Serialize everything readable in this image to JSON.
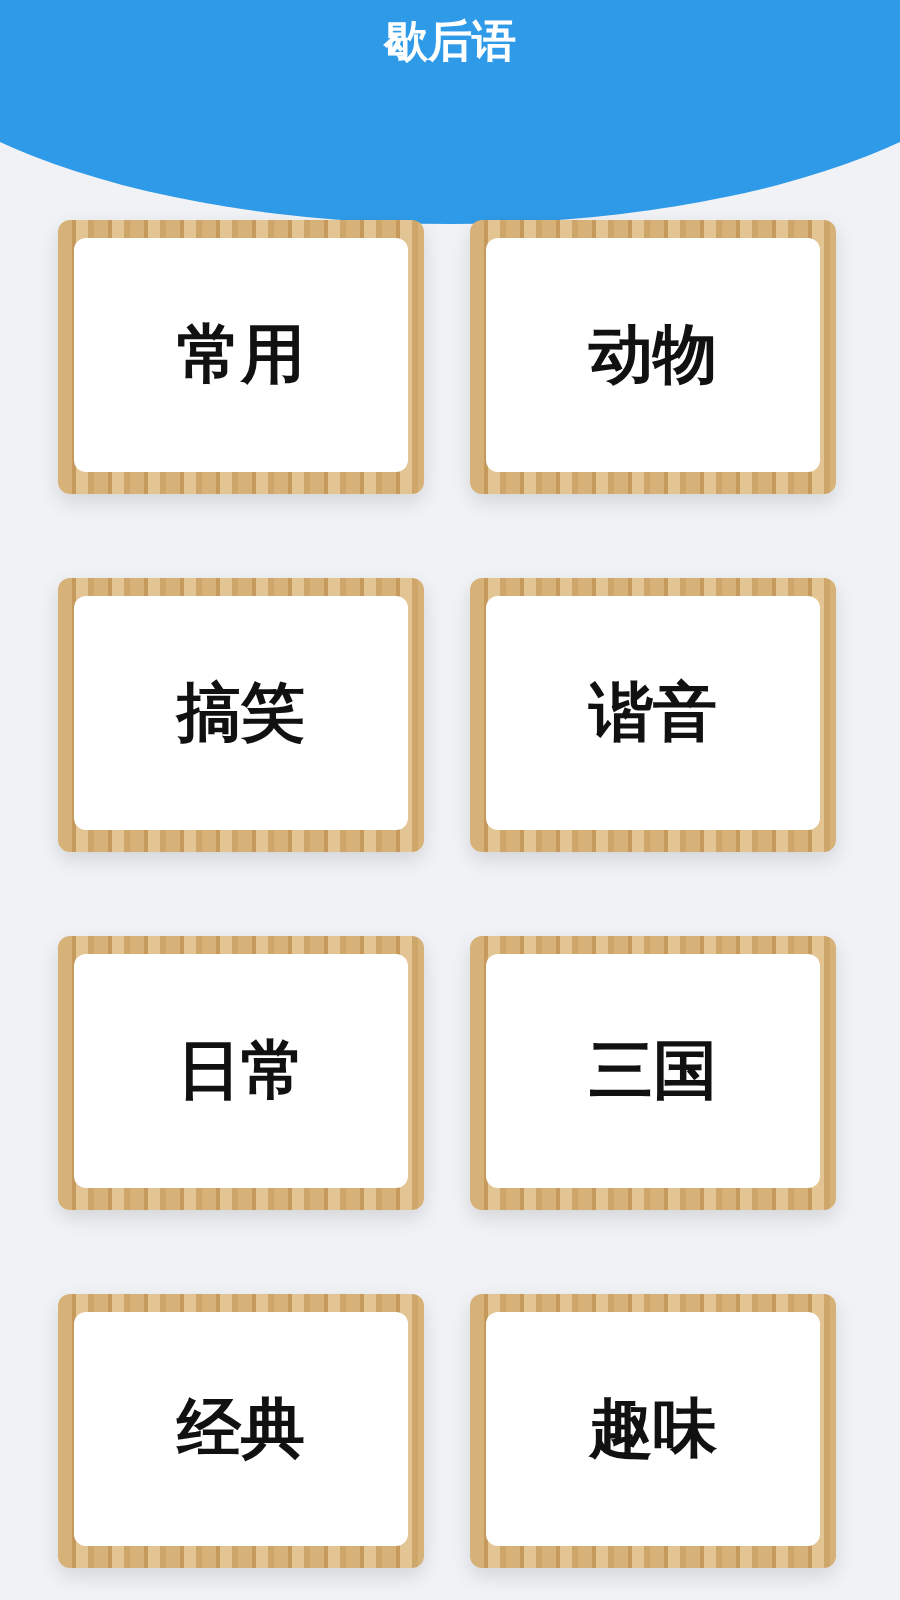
{
  "header": {
    "title": "歇后语"
  },
  "categories": [
    {
      "label": "常用"
    },
    {
      "label": "动物"
    },
    {
      "label": "搞笑"
    },
    {
      "label": "谐音"
    },
    {
      "label": "日常"
    },
    {
      "label": "三国"
    },
    {
      "label": "经典"
    },
    {
      "label": "趣味"
    }
  ]
}
